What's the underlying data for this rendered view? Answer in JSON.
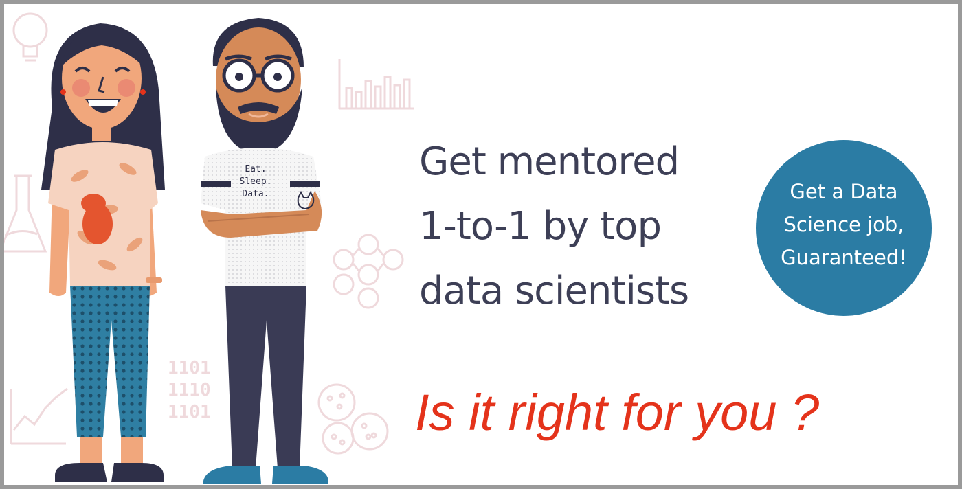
{
  "headline": {
    "line1": "Get mentored",
    "line2": "1-to-1 by top",
    "line3": "data scientists"
  },
  "badge": {
    "line1": "Get a Data",
    "line2": "Science job,",
    "line3": "Guaranteed!"
  },
  "cta": "Is it right for you ?",
  "shirt": {
    "line1": "Eat.",
    "line2": "Sleep.",
    "line3": "Data."
  },
  "binary": [
    "1101",
    "1110",
    "1101"
  ],
  "colors": {
    "headline": "#3d3f56",
    "badge": "#2b7ca4",
    "cta": "#e4331b",
    "doodle": "#efd9dc"
  }
}
